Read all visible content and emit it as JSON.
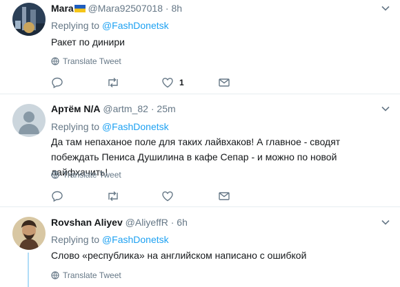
{
  "tweets": [
    {
      "name": "Mara",
      "handle": "@Mara92507018",
      "dot": "·",
      "time": "8h",
      "replying_prefix": "Replying to",
      "replying_to": "@FashDonetsk",
      "text": "Ракет по динири",
      "translate": "Translate Tweet",
      "likes": "1",
      "name_badge": "flag-ukraine-icon"
    },
    {
      "name": "Артём N/A",
      "handle": "@artm_82",
      "dot": "·",
      "time": "25m",
      "replying_prefix": "Replying to",
      "replying_to": "@FashDonetsk",
      "text": "Да там непаханое поле для таких лайвхаков! А главное - сводят побеждать Пениса Душилина в кафе Сепар - и можно по новой лайфхачить!",
      "translate": "Translate Tweet"
    },
    {
      "name": "Rovshan Aliyev",
      "handle": "@AliyeffR",
      "dot": "·",
      "time": "6h",
      "replying_prefix": "Replying to",
      "replying_to": "@FashDonetsk",
      "text": "Слово «республика» на английском написано с ошибкой",
      "translate": "Translate Tweet"
    }
  ],
  "colors": {
    "accent": "#1da1f2",
    "muted": "#657786",
    "text": "#14171a",
    "divider": "#e6ecf0",
    "thread": "#b0dcf7"
  }
}
